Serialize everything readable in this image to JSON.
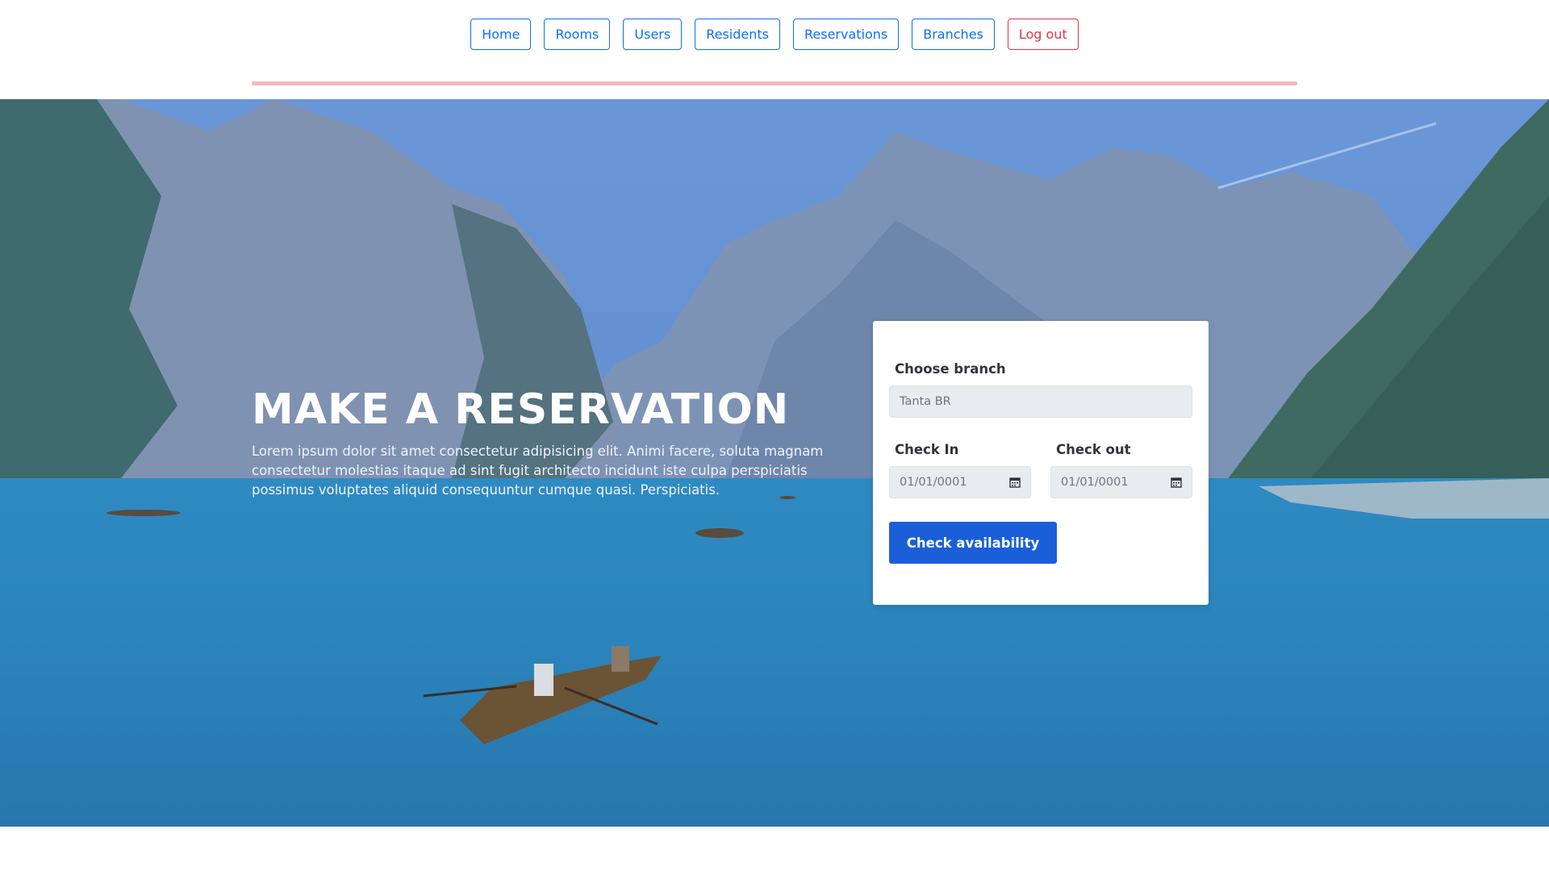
{
  "nav": {
    "items": [
      {
        "label": "Home"
      },
      {
        "label": "Rooms"
      },
      {
        "label": "Users"
      },
      {
        "label": "Residents"
      },
      {
        "label": "Reservations"
      },
      {
        "label": "Branches"
      }
    ],
    "logout_label": "Log out"
  },
  "colors": {
    "nav_accent": "#0d6efd",
    "logout_accent": "#dc3545",
    "divider": "#f3b9bf",
    "primary_button": "#1a5fd8"
  },
  "hero": {
    "title": "MAKE A RESERVATION",
    "text": "Lorem ipsum dolor sit amet consectetur adipisicing elit. Animi facere, soluta magnam consectetur molestias itaque ad sint fugit architecto incidunt iste culpa perspiciatis possimus voluptates aliquid consequuntur cumque quasi. Perspiciatis."
  },
  "booking": {
    "branch_label": "Choose branch",
    "branch_value": "Tanta BR",
    "checkin_label": "Check In",
    "checkin_value": "01/01/0001",
    "checkout_label": "Check out",
    "checkout_value": "01/01/0001",
    "button_label": "Check availability",
    "date_icon": "calendar-icon"
  }
}
